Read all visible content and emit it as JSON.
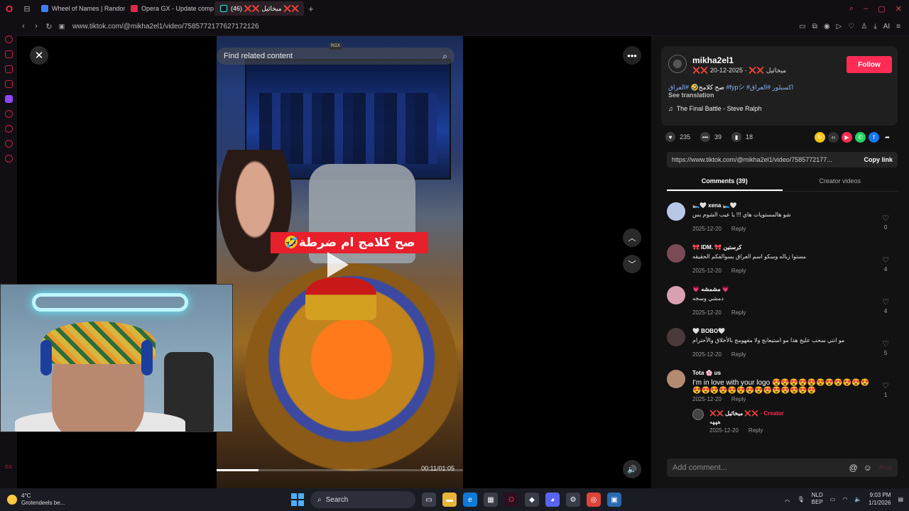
{
  "browser": {
    "workspace_icon": "⊟",
    "tabs": [
      {
        "label": "Wheel of Names | Random",
        "color": "#3b82f6",
        "active": false
      },
      {
        "label": "Opera GX - Update comp",
        "color": "#e0294a",
        "active": false
      },
      {
        "label": "(46) ❌❌ ميخائيل ❌❌",
        "color": "#111111",
        "active": true
      }
    ],
    "new_tab": "+",
    "url": "www.tiktok.com/@mikha2el1/video/7585772177627172126",
    "nav": {
      "back": "‹",
      "forward": "›",
      "reload": "↻",
      "lock": "🔒"
    },
    "toolbar": [
      "▭",
      "⧉",
      "◉",
      "▷",
      "♡",
      "♙",
      "⤓",
      "AI",
      "≡"
    ]
  },
  "video": {
    "search_placeholder": "Find related content",
    "rgx_badge": "RGX",
    "caption": "صح كلامج ام ضرطة🤣",
    "time": "00:11/01:05",
    "progress": 0.17
  },
  "controls": {
    "close": "✕",
    "more": "•••",
    "up": "︿",
    "down": "﹀",
    "volume": "🔊"
  },
  "author": {
    "username": "mikha2el1",
    "nickname": "❌❌ ميخائيل ❌❌",
    "date": "2025-12-20",
    "follow": "Follow",
    "description_text": "صح كلامج🤣 ",
    "hashtags": "#العراق #fypシ #اكسبلور #العراق",
    "see_translation": "See translation",
    "music": "The Final Battle - Steve Ralph"
  },
  "stats": {
    "likes": "235",
    "comments": "39",
    "saves": "18"
  },
  "link": {
    "url": "https://www.tiktok.com/@mikha2el1/video/7585772177...",
    "copy": "Copy link"
  },
  "panel_tabs": {
    "comments": "Comments (39)",
    "creator_videos": "Creator videos"
  },
  "comments": [
    {
      "name": "🛌🤍 xena 🛌🤍",
      "text": "شو هالمستويات هاي !!! يا عيب الشوم بس",
      "date": "2025-12-20",
      "reply": "Reply",
      "likes": "0",
      "avatar": "#b9c6e6"
    },
    {
      "name": "🎀 IDM. 🎀 كرستين",
      "text": "مستوا زباله وسكو اسم العراق بسوالفكم الحقيقه",
      "date": "2025-12-20",
      "reply": "Reply",
      "likes": "4",
      "avatar": "#7a4a55"
    },
    {
      "name": "💗 مشمشه 💗",
      "text": "دمشي وسخه",
      "date": "2025-12-20",
      "reply": "Reply",
      "likes": "4",
      "avatar": "#d8a0b0"
    },
    {
      "name": "🤍 BOBO🤍",
      "text": "مو انتي سحب عليج هذا مو استيعابج ولا مفهومج بالأخلاق والأحترام",
      "date": "2025-12-20",
      "reply": "Reply",
      "likes": "5",
      "avatar": "#4a3a3a"
    }
  ],
  "big_comment": {
    "name": "Tota 🌸 us",
    "text": "I'm in love with your logo 😍😍😍😍😍😍😍😍😍😍😍😍😍😍😍😍😍😍😍😍😍😍😍😍😍",
    "date": "2025-12-20",
    "reply": "Reply",
    "likes": "1",
    "sub": {
      "name": "❌❌ ميخائيل ❌❌",
      "creator": "· Creator",
      "text": "هههه",
      "date": "2025-12-20",
      "reply": "Reply",
      "likes": "0"
    }
  },
  "add_comment": {
    "placeholder": "Add comment...",
    "mention": "@",
    "emoji": "☺",
    "post": "Post"
  },
  "taskbar": {
    "weather_temp": "4°C",
    "weather_text": "Grotendeels be...",
    "search": "Search",
    "lang_1": "NLD",
    "lang_2": "BEP",
    "time": "9:03 PM",
    "date": "1/1/2026"
  }
}
